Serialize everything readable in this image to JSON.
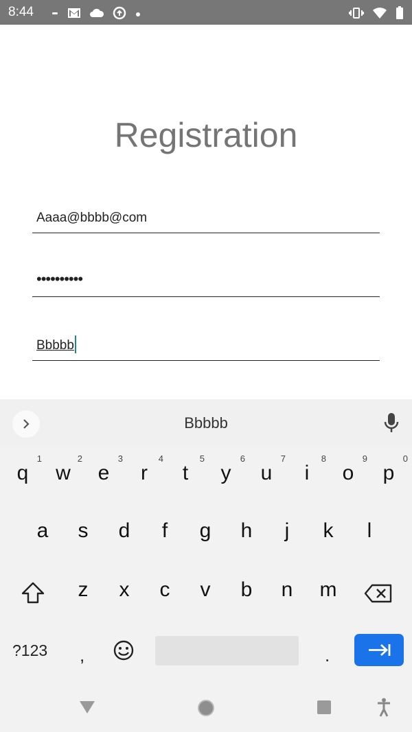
{
  "status_bar": {
    "time": "8:44",
    "left_icons": [
      "notification-dot-icon",
      "gmail-icon",
      "cloud-icon",
      "sync-icon",
      "dot-icon"
    ],
    "right_icons": [
      "vibrate-icon",
      "wifi-icon",
      "battery-icon"
    ]
  },
  "page": {
    "title": "Registration",
    "email_value": "Aaaa@bbbb@com",
    "password_value": "••••••••••",
    "name_value": "Bbbbb"
  },
  "keyboard": {
    "suggestion": "Bbbbb",
    "row1": [
      {
        "key": "q",
        "hint": "1"
      },
      {
        "key": "w",
        "hint": "2"
      },
      {
        "key": "e",
        "hint": "3"
      },
      {
        "key": "r",
        "hint": "4"
      },
      {
        "key": "t",
        "hint": "5"
      },
      {
        "key": "y",
        "hint": "6"
      },
      {
        "key": "u",
        "hint": "7"
      },
      {
        "key": "i",
        "hint": "8"
      },
      {
        "key": "o",
        "hint": "9"
      },
      {
        "key": "p",
        "hint": "0"
      }
    ],
    "row2": [
      "a",
      "s",
      "d",
      "f",
      "g",
      "h",
      "j",
      "k",
      "l"
    ],
    "row3": [
      "z",
      "x",
      "c",
      "v",
      "b",
      "n",
      "m"
    ],
    "symbols_label": "?123",
    "comma_label": ",",
    "period_label": "."
  },
  "colors": {
    "accent": "#1a73e8",
    "caret": "#1a8a84",
    "title": "#757575",
    "status_bar": "#777777"
  }
}
